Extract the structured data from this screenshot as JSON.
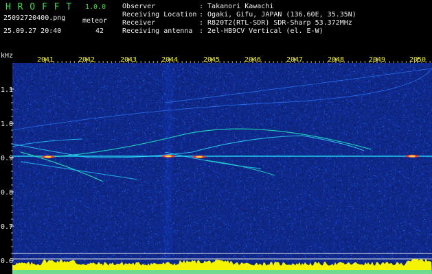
{
  "header": {
    "app_name": "H R O F F T",
    "version": "1.0.0",
    "filename": "25092720400.png",
    "datetime": "25.09.27 20:40",
    "meteor_label": "meteor",
    "meteor_count": "42"
  },
  "info": {
    "fields": [
      {
        "label": "Observer",
        "value": ": Takanori Kawachi"
      },
      {
        "label": "Receiving Location",
        "value": ": Ogaki, Gifu, JAPAN (136.60E, 35.35N)"
      },
      {
        "label": "Receiver",
        "value": ": R820T2(RTL-SDR) SDR-Sharp 53.372MHz"
      },
      {
        "label": "Receiving antenna",
        "value": ": 2el-HB9CV Vertical (el. E-W)"
      }
    ]
  },
  "axes": {
    "y_unit": "kHz",
    "time_ticks": [
      "2041",
      "2042",
      "2043",
      "2044",
      "2045",
      "2046",
      "2047",
      "2048",
      "2049",
      "2050"
    ],
    "freq_ticks": [
      "1.1",
      "1.0",
      "0.9",
      "0.8",
      "0.7",
      "0.6"
    ]
  },
  "colors": {
    "green": "#3ddf3d",
    "white": "#f0f0f0",
    "yellow": "#f4f400",
    "cyan": "#00c8ff",
    "background": "#000000",
    "noise": "#0a147a"
  }
}
